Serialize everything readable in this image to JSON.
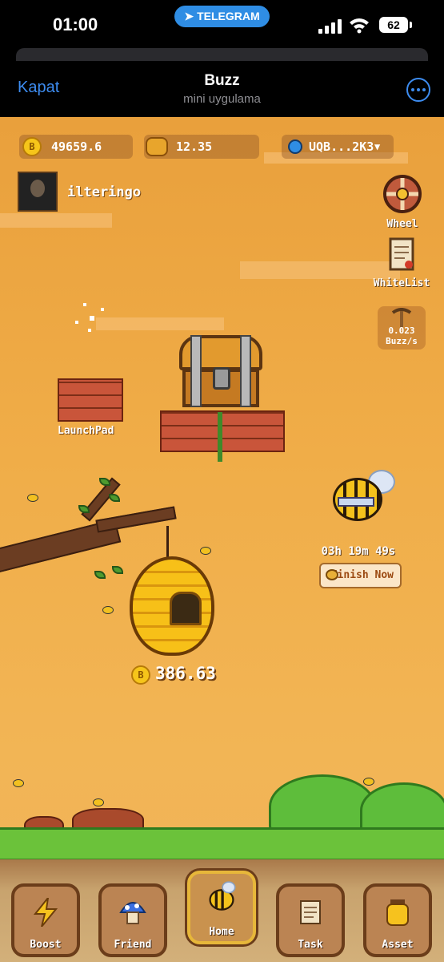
{
  "status_bar": {
    "time": "01:00",
    "telegram_label": "TELEGRAM",
    "battery": "62"
  },
  "header": {
    "close_label": "Kapat",
    "title": "Buzz",
    "subtitle": "mini uygulama"
  },
  "hud": {
    "coin_balance": "49659.6",
    "honey_balance": "12.35",
    "wallet": "UQB...2K3"
  },
  "user": {
    "name": "ilteringo"
  },
  "side_buttons": {
    "wheel": "Wheel",
    "whitelist": "WhiteList",
    "rate_value": "0.023",
    "rate_unit": "Buzz/s"
  },
  "launchpad_label": "LaunchPad",
  "bee": {
    "timer": "03h 19m 49s",
    "finish_label": "Finish Now"
  },
  "hive": {
    "amount": "386.63"
  },
  "nav": {
    "items": [
      {
        "label": "Boost"
      },
      {
        "label": "Friend"
      },
      {
        "label": "Home"
      },
      {
        "label": "Task"
      },
      {
        "label": "Asset"
      }
    ]
  },
  "colors": {
    "sky": "#f0ad48",
    "accent_blue": "#3d8cf0",
    "telegram_blue": "#2f8de4"
  }
}
